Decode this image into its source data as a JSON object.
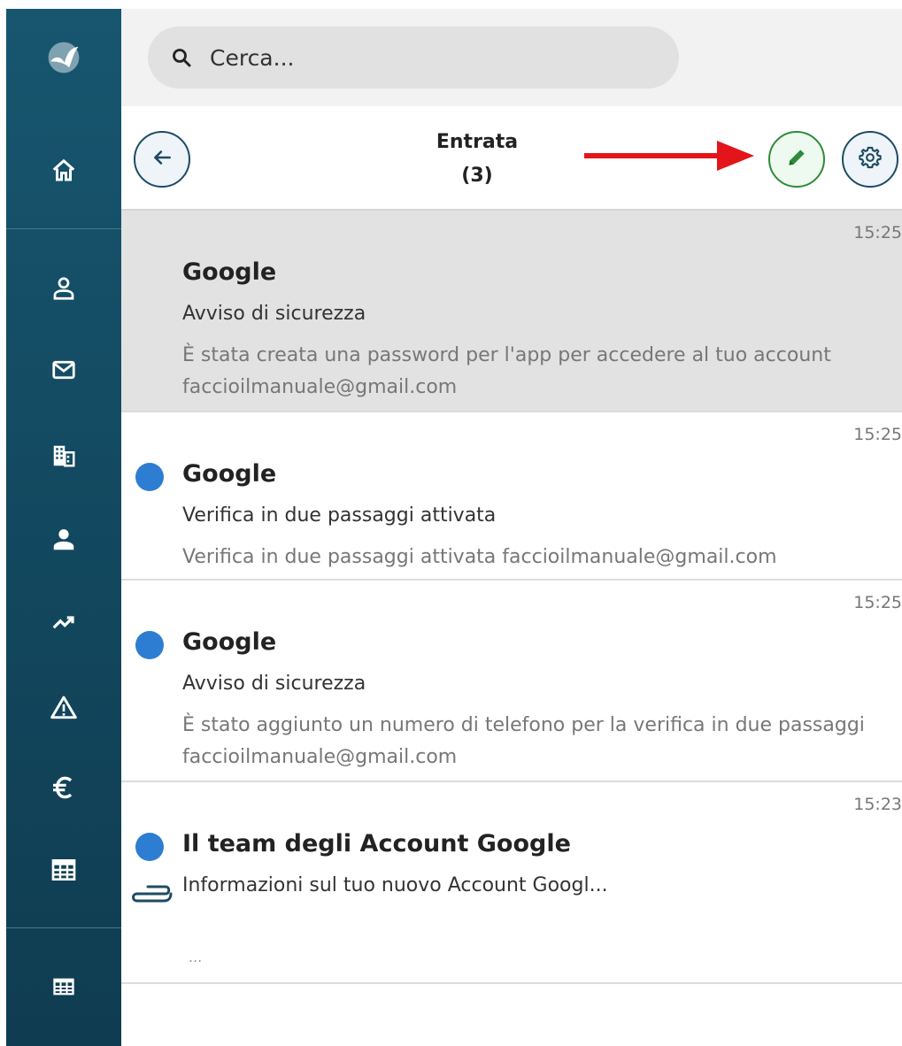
{
  "search": {
    "placeholder": "Cerca..."
  },
  "header": {
    "title": "Entrata",
    "count": "(3)"
  },
  "sidebar": {
    "items": [
      {
        "icon": "logo-icon"
      },
      {
        "icon": "home-icon"
      },
      {
        "icon": "contacts-icon"
      },
      {
        "icon": "mail-icon"
      },
      {
        "icon": "building-icon"
      },
      {
        "icon": "person-icon"
      },
      {
        "icon": "trending-icon"
      },
      {
        "icon": "warning-icon"
      },
      {
        "icon": "euro-icon"
      },
      {
        "icon": "table-icon"
      },
      {
        "icon": "apps-grid-icon"
      }
    ]
  },
  "messages": [
    {
      "time": "15:25",
      "sender": "Google",
      "subject": "Avviso di sicurezza",
      "preview": "È stata creata una password per l'app per accedere al tuo account faccioilmanuale@gmail.com",
      "unread": false,
      "selected": true
    },
    {
      "time": "15:25",
      "sender": "Google",
      "subject": "Verifica in due passaggi attivata",
      "preview": "Verifica in due passaggi attivata faccioilmanuale@gmail.com",
      "unread": true
    },
    {
      "time": "15:25",
      "sender": "Google",
      "subject": "Avviso di sicurezza",
      "preview": "È stato aggiunto un numero di telefono per la verifica in due passaggi faccioilmanuale@gmail.com",
      "unread": true
    },
    {
      "time": "15:23",
      "sender": "Il team degli Account Google",
      "subject": "Informazioni sul tuo nuovo Account Googl...",
      "preview": "...",
      "unread": true,
      "attachment": true
    }
  ],
  "colors": {
    "sidebar": "#17566f",
    "unread_dot": "#2d7dd2",
    "compose_border": "#2e8b3a",
    "annotation_arrow": "#e3151a"
  }
}
